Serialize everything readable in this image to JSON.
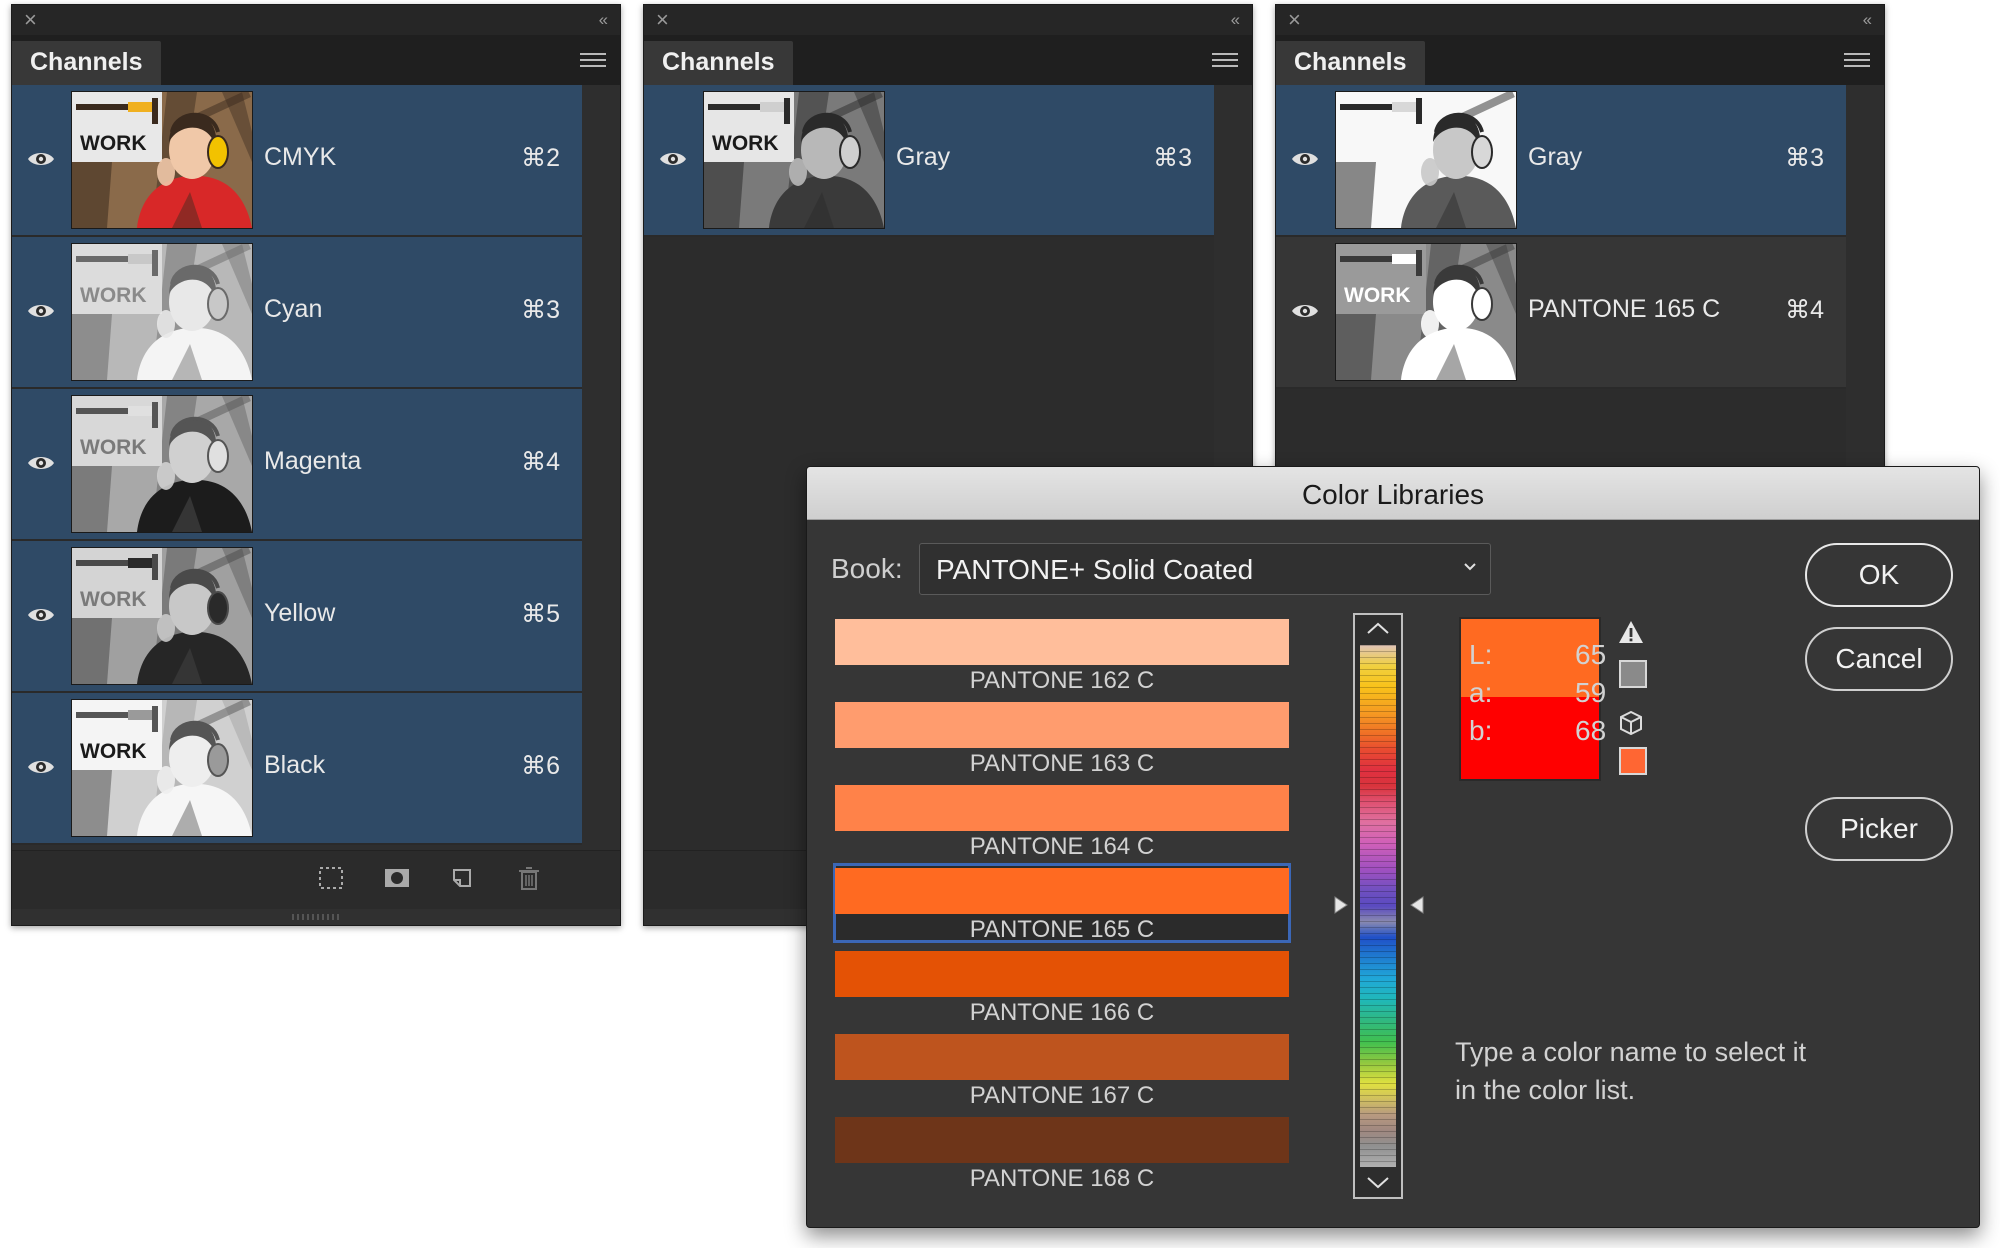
{
  "panels": [
    {
      "tab_label": "Channels",
      "channels": [
        {
          "name": "CMYK",
          "shortcut": "⌘2",
          "thumb": "cmyk"
        },
        {
          "name": "Cyan",
          "shortcut": "⌘3",
          "thumb": "cyan"
        },
        {
          "name": "Magenta",
          "shortcut": "⌘4",
          "thumb": "magenta"
        },
        {
          "name": "Yellow",
          "shortcut": "⌘5",
          "thumb": "yellow"
        },
        {
          "name": "Black",
          "shortcut": "⌘6",
          "thumb": "black"
        }
      ]
    },
    {
      "tab_label": "Channels",
      "channels": [
        {
          "name": "Gray",
          "shortcut": "⌘3",
          "thumb": "gray"
        }
      ]
    },
    {
      "tab_label": "Channels",
      "channels": [
        {
          "name": "Gray",
          "shortcut": "⌘3",
          "thumb": "gray-light"
        },
        {
          "name": "PANTONE 165 C",
          "shortcut": "⌘4",
          "thumb": "pantone"
        }
      ]
    }
  ],
  "thumbnail_sign_text": "WORK",
  "dialog": {
    "title": "Color Libraries",
    "book_label": "Book:",
    "book_value": "PANTONE+ Solid Coated",
    "swatches": [
      {
        "name": "PANTONE 162 C",
        "color": "#FFBE9B"
      },
      {
        "name": "PANTONE 163 C",
        "color": "#FF9C6E"
      },
      {
        "name": "PANTONE 164 C",
        "color": "#FF8249"
      },
      {
        "name": "PANTONE 165 C",
        "color": "#FF6A21",
        "selected": true
      },
      {
        "name": "PANTONE 166 C",
        "color": "#E45205"
      },
      {
        "name": "PANTONE 167 C",
        "color": "#BE541E"
      },
      {
        "name": "PANTONE 168 C",
        "color": "#6E3519"
      }
    ],
    "preview_new_color": "#FF6A21",
    "preview_original_color": "#FF0000",
    "web_safe_color": "#FF6633",
    "lab": [
      {
        "label": "L:",
        "value": "65"
      },
      {
        "label": "a:",
        "value": "59"
      },
      {
        "label": "b:",
        "value": "68"
      }
    ],
    "hint": "Type a color name to select it in the color list.",
    "buttons": {
      "ok": "OK",
      "cancel": "Cancel",
      "picker": "Picker"
    }
  },
  "colors": {
    "selection_blue": "#2F4A66",
    "swatch_focus": "#3B67B7",
    "panel_bg": "#2E2E2E"
  }
}
